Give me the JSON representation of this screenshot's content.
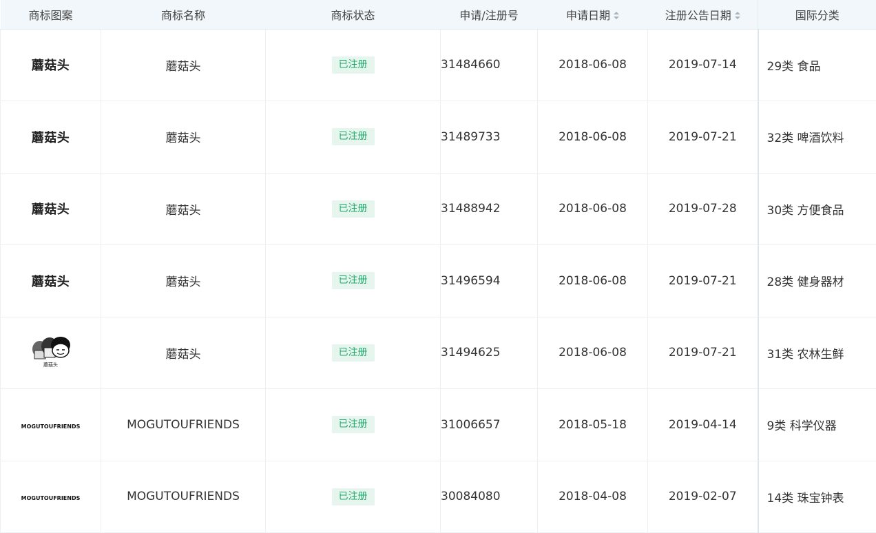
{
  "columns": {
    "image": "商标图案",
    "name": "商标名称",
    "status": "商标状态",
    "reg_no": "申请/注册号",
    "apply_date": "申请日期",
    "publish_date": "注册公告日期",
    "intl_class": "国际分类"
  },
  "colors": {
    "status_text": "#1fa86a",
    "status_bg": "#e6f6ee",
    "header_bg": "#f2f7fb"
  },
  "rows": [
    {
      "logo_type": "text",
      "logo_text": "蘑菇头",
      "name": "蘑菇头",
      "status": "已注册",
      "reg_no": "31484660",
      "apply_date": "2018-06-08",
      "publish_date": "2019-07-14",
      "intl_class": "29类 食品"
    },
    {
      "logo_type": "text",
      "logo_text": "蘑菇头",
      "name": "蘑菇头",
      "status": "已注册",
      "reg_no": "31489733",
      "apply_date": "2018-06-08",
      "publish_date": "2019-07-21",
      "intl_class": "32类 啤酒饮料"
    },
    {
      "logo_type": "text",
      "logo_text": "蘑菇头",
      "name": "蘑菇头",
      "status": "已注册",
      "reg_no": "31488942",
      "apply_date": "2018-06-08",
      "publish_date": "2019-07-28",
      "intl_class": "30类 方便食品"
    },
    {
      "logo_type": "text",
      "logo_text": "蘑菇头",
      "name": "蘑菇头",
      "status": "已注册",
      "reg_no": "31496594",
      "apply_date": "2018-06-08",
      "publish_date": "2019-07-21",
      "intl_class": "28类 健身器材"
    },
    {
      "logo_type": "cartoon",
      "logo_text": "蘑菇头",
      "name": "蘑菇头",
      "status": "已注册",
      "reg_no": "31494625",
      "apply_date": "2018-06-08",
      "publish_date": "2019-07-21",
      "intl_class": "31类 农林生鲜"
    },
    {
      "logo_type": "text-en",
      "logo_text": "MOGUTOUFRIENDS",
      "name": "MOGUTOUFRIENDS",
      "status": "已注册",
      "reg_no": "31006657",
      "apply_date": "2018-05-18",
      "publish_date": "2019-04-14",
      "intl_class": "9类 科学仪器"
    },
    {
      "logo_type": "text-en",
      "logo_text": "MOGUTOUFRIENDS",
      "name": "MOGUTOUFRIENDS",
      "status": "已注册",
      "reg_no": "30084080",
      "apply_date": "2018-04-08",
      "publish_date": "2019-02-07",
      "intl_class": "14类 珠宝钟表"
    }
  ]
}
